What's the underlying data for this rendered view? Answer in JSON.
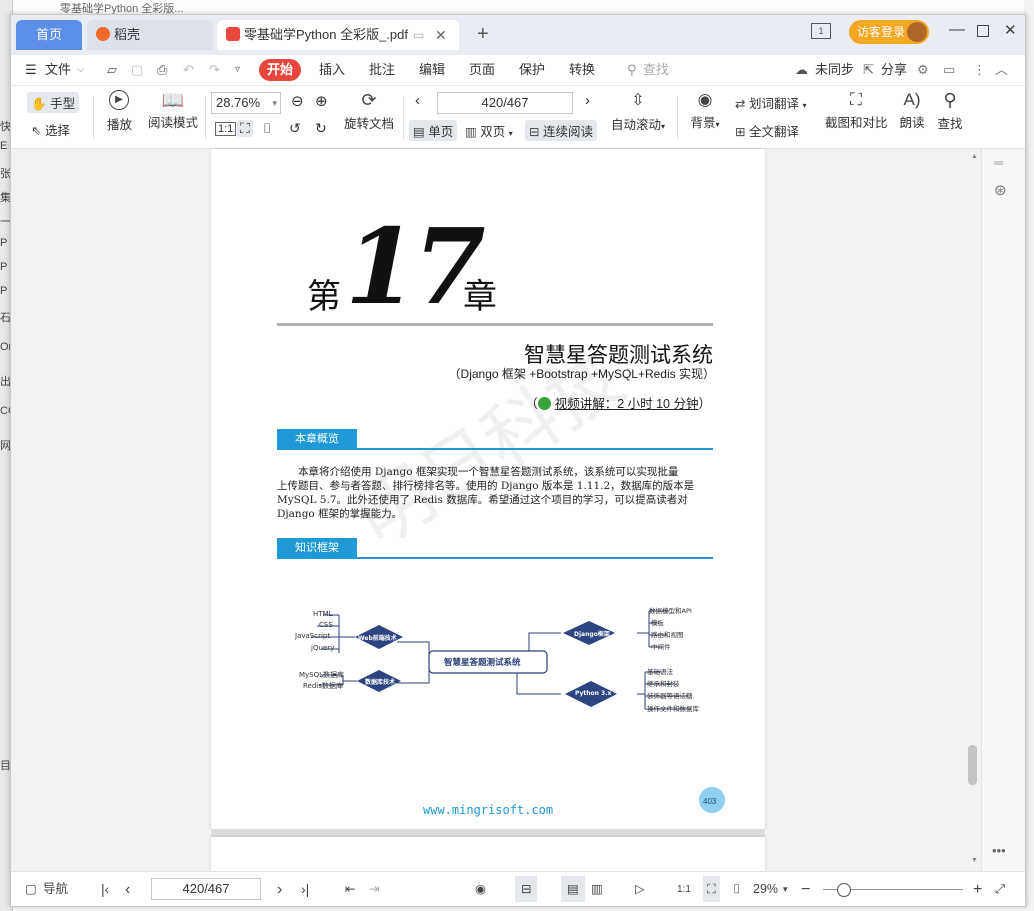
{
  "background": {
    "left_fragments": [
      "快",
      "E",
      "张",
      "集",
      "一",
      "P",
      "P",
      "P",
      "石",
      "On",
      "出",
      "CO",
      "网",
      "目"
    ],
    "top_fragment": "零基础学Python 全彩版..."
  },
  "titlebar": {
    "home_tab": "首页",
    "daoke_tab": "稻壳",
    "doc_tab": "零基础学Python 全彩版_.pdf",
    "new_tab": "+",
    "guest_login": "访客登录",
    "icons": [
      "panel-icon",
      "minimize-icon",
      "maximize-icon",
      "close-icon"
    ]
  },
  "menubar": {
    "file": "文件",
    "items": [
      "开始",
      "插入",
      "批注",
      "编辑",
      "页面",
      "保护",
      "转换"
    ],
    "active": "开始",
    "search_placeholder": "查找",
    "unsync": "未同步",
    "share": "分享"
  },
  "toolbar": {
    "hand": "手型",
    "select": "选择",
    "play": "播放",
    "read_mode": "阅读模式",
    "zoom": "28.76%",
    "rotate_doc": "旋转文档",
    "page_indicator": "420/467",
    "single_page": "单页",
    "double_page": "双页",
    "continuous": "连续阅读",
    "auto_scroll": "自动滚动",
    "background": "背景",
    "word_translate": "划词翻译",
    "full_translate": "全文翻译",
    "screenshot_compare": "截图和对比",
    "read_aloud": "朗读",
    "find": "查找"
  },
  "page": {
    "chapter_prefix": "第",
    "chapter_number": "17",
    "chapter_suffix": "章",
    "title": "智慧星答题测试系统",
    "subtitle": "（Django 框架 +Bootstrap +MySQL+Redis 实现）",
    "video": "视频讲解：2 小时 10 分钟",
    "video_paren_open": "（",
    "video_paren_close": "）",
    "watermark": "明日科技",
    "section1": "本章概览",
    "overview_lines": [
      "本章将介绍使用 Django 框架实现一个智慧星答题测试系统，该系统可以实现批量",
      "上传题目、参与者答题、排行榜排名等。使用的 Django 版本是 1.11.2，数据库的版本是",
      "MySQL 5.7。此外还使用了 Redis 数据库。希望通过这个项目的学习，可以提高读者对",
      "Django 框架的掌握能力。"
    ],
    "section2": "知识框架",
    "mindmap": {
      "center": "智慧星答题测试系统",
      "web_node": "Web前端技术",
      "web_leaves": [
        "HTML",
        "CSS",
        "JavaScript",
        "jQuery"
      ],
      "db_node": "数据库技术",
      "db_leaves": [
        "MySQL数据库",
        "Redis数据库"
      ],
      "django_node": "Django框架",
      "django_leaves": [
        "数据模型和API",
        "模板",
        "路由和视图",
        "中间件"
      ],
      "python_node": "Python 3.x",
      "python_leaves": [
        "基础语法",
        "继承和封装",
        "装饰器等语法糖",
        "操作文件和数据库"
      ]
    },
    "footer_url": "www.mingrisoft.com",
    "page_number": "403",
    "next_page_number": "1"
  },
  "statusbar": {
    "nav": "导航",
    "page_indicator": "420/467",
    "zoom": "29%",
    "colors": {
      "accent": "#1f9ad6",
      "active_menu": "#e9473e",
      "guest": "#f5a623",
      "home_tab": "#5b8ee6"
    }
  }
}
